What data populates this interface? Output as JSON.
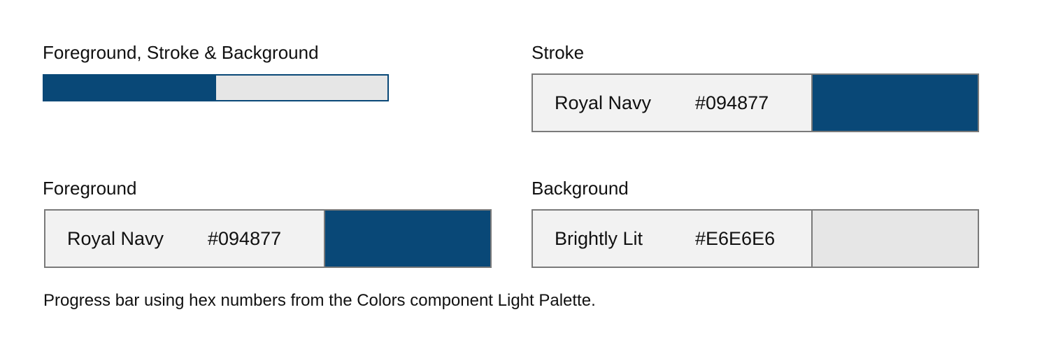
{
  "progress_section": {
    "label": "Foreground, Stroke & Background",
    "progress_fraction": 0.5,
    "foreground_color": "#094877",
    "stroke_color": "#094877",
    "background_color": "#E6E6E6"
  },
  "stroke": {
    "label": "Stroke",
    "color_name": "Royal Navy",
    "hex": "#094877",
    "swatch_color": "#094877"
  },
  "foreground": {
    "label": "Foreground",
    "color_name": "Royal Navy",
    "hex": "#094877",
    "swatch_color": "#094877"
  },
  "background": {
    "label": "Background",
    "color_name": "Brightly Lit",
    "hex": "#E6E6E6",
    "swatch_color": "#E6E6E6"
  },
  "caption": "Progress bar using hex numbers from the Colors component Light Palette."
}
